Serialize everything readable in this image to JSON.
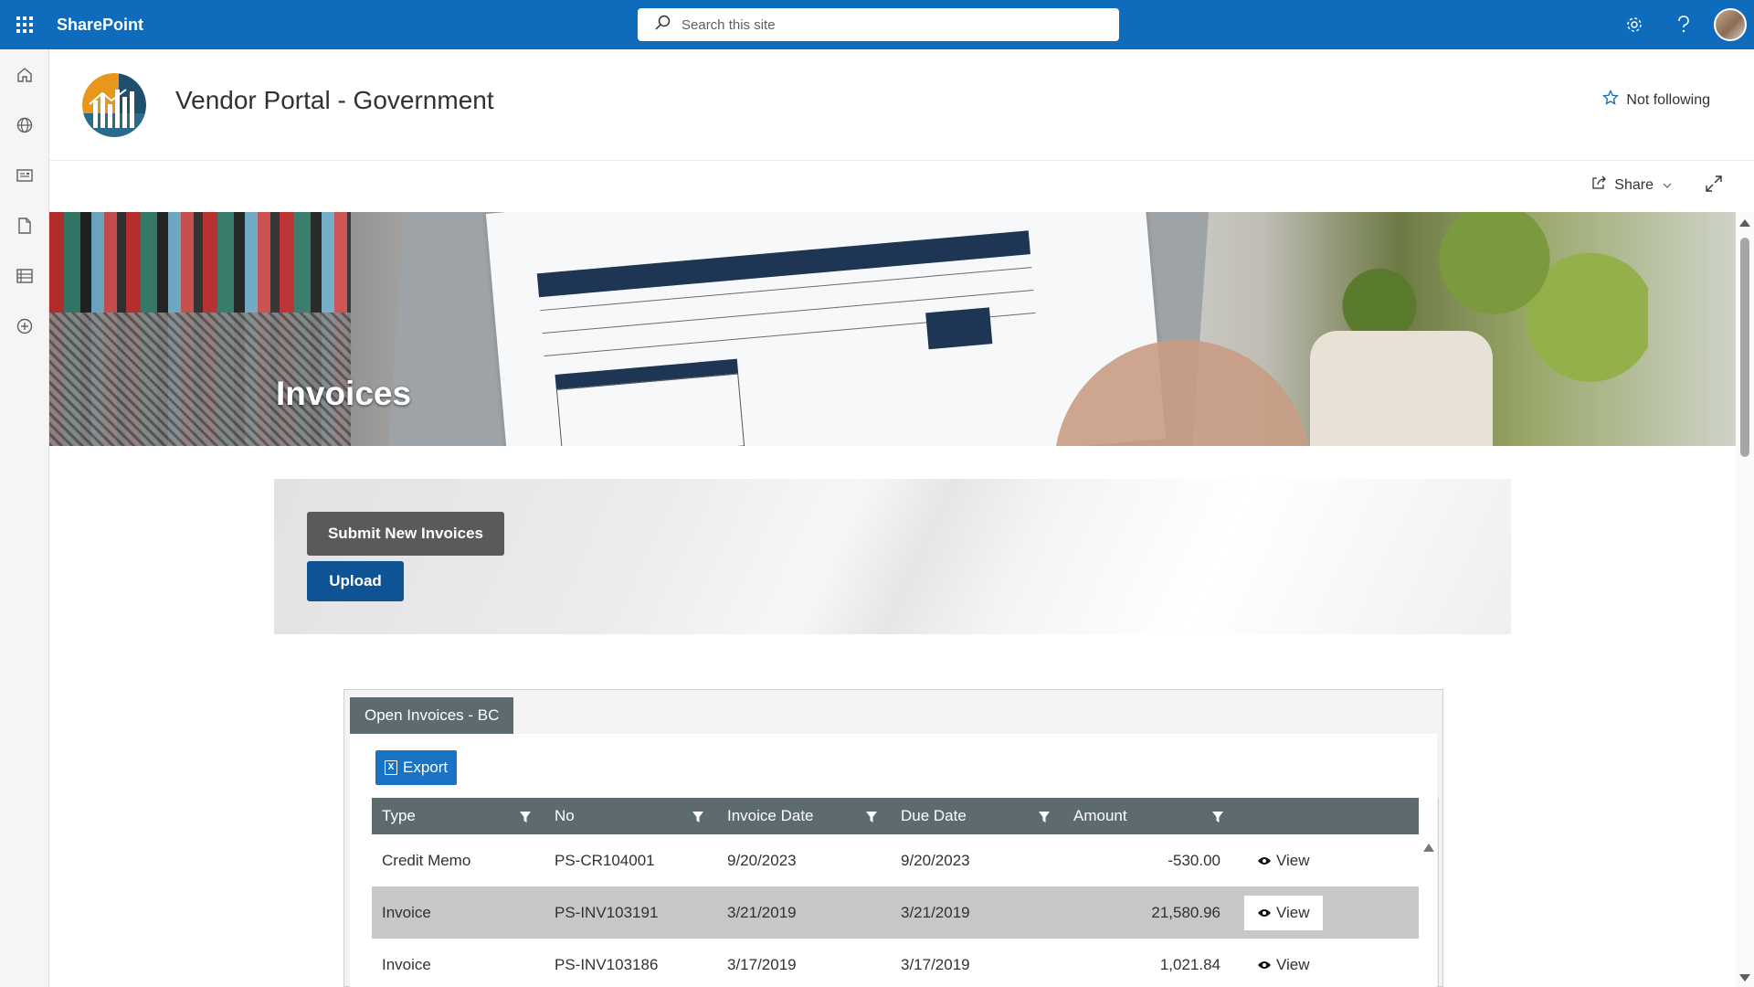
{
  "suite": {
    "brand": "SharePoint",
    "search_placeholder": "Search this site",
    "icons": [
      "waffle-icon",
      "settings-icon",
      "help-icon",
      "avatar"
    ],
    "accent_color": "#0f6cbd"
  },
  "rail": {
    "items": [
      "home-icon",
      "globe-icon",
      "news-icon",
      "document-icon",
      "list-icon",
      "add-icon"
    ]
  },
  "site": {
    "title": "Vendor Portal - Government",
    "follow_label": "Not following"
  },
  "command_bar": {
    "share_label": "Share"
  },
  "hero": {
    "title": "Invoices"
  },
  "actions": {
    "submit_label": "Submit New Invoices",
    "upload_label": "Upload"
  },
  "invoices": {
    "tab_label": "Open Invoices - BC",
    "export_label": "Export",
    "columns": [
      "Type",
      "No",
      "Invoice Date",
      "Due Date",
      "Amount"
    ],
    "rows": [
      {
        "type": "Credit Memo",
        "no": "PS-CR104001",
        "invoice_date": "9/20/2023",
        "due_date": "9/20/2023",
        "amount": "-530.00",
        "action": "View"
      },
      {
        "type": "Invoice",
        "no": "PS-INV103191",
        "invoice_date": "3/21/2019",
        "due_date": "3/21/2019",
        "amount": "21,580.96",
        "action": "View"
      },
      {
        "type": "Invoice",
        "no": "PS-INV103186",
        "invoice_date": "3/17/2019",
        "due_date": "3/17/2019",
        "amount": "1,021.84",
        "action": "View"
      }
    ]
  }
}
